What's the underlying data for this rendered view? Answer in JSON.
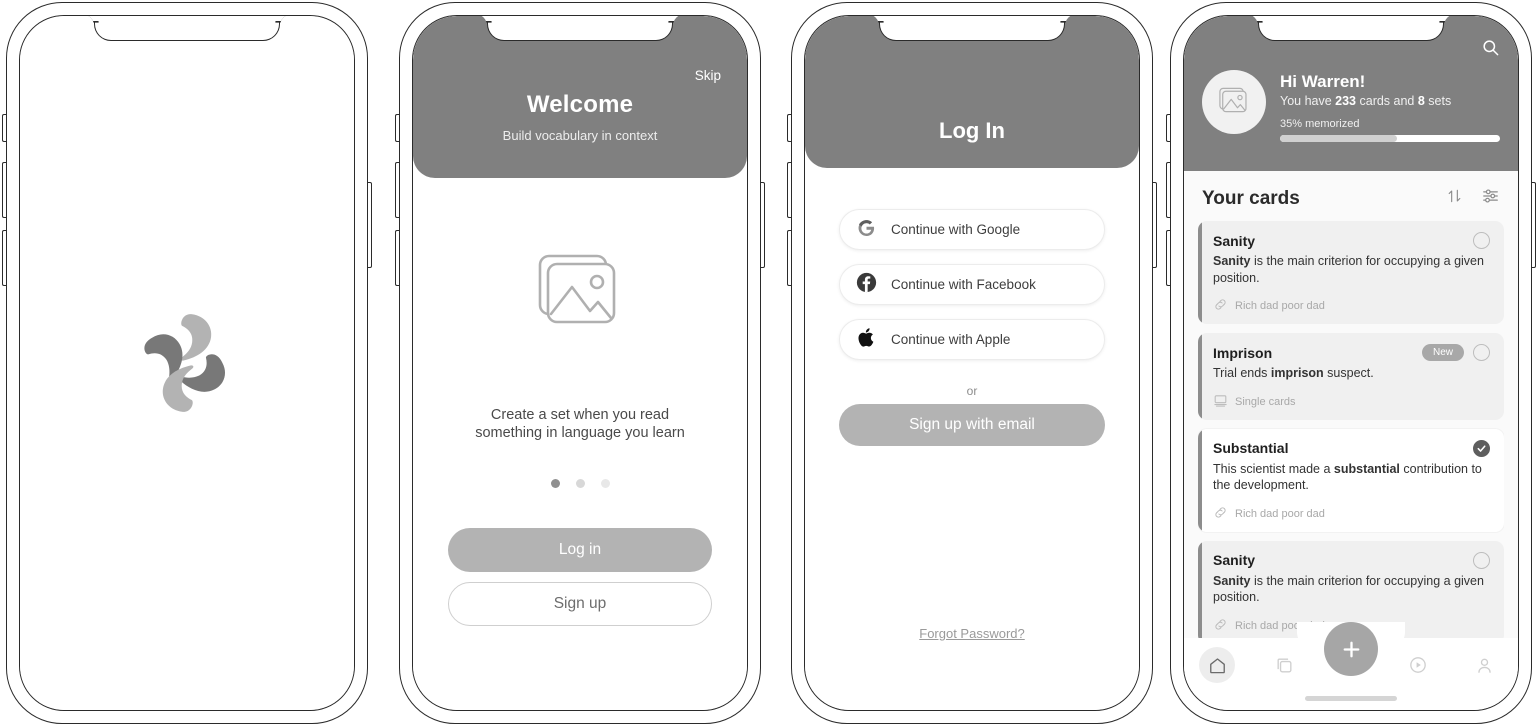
{
  "theme": {
    "header_gray": "#808080",
    "accent_gray": "#b3b3b3",
    "logo_dark": "#787878",
    "logo_light": "#b3b3b3",
    "card_bg": "#f0f0f0",
    "text_dark": "#1f1f1f"
  },
  "screens": [
    {
      "id": "splash",
      "name": "Splash",
      "logo_icon": "pinwheel-quotes-logo"
    },
    {
      "id": "welcome",
      "name": "Welcome / Onboarding",
      "skip_label": "Skip",
      "title": "Welcome",
      "subtitle": "Build vocabulary in context",
      "illustration_icon": "image-placeholder-icon",
      "body_line1": "Create a set when you read",
      "body_line2": "something in language you learn",
      "dots": [
        {
          "active": true,
          "color": "#909090"
        },
        {
          "active": false,
          "color": "#d8d8d8"
        },
        {
          "active": false,
          "color": "#e8e8e8"
        }
      ],
      "primary_button": "Log  in",
      "secondary_button": "Sign up"
    },
    {
      "id": "login",
      "name": "Log In",
      "title": "Log In",
      "social_buttons": [
        {
          "icon": "google-icon",
          "label": "Continue with Google"
        },
        {
          "icon": "facebook-icon",
          "label": "Continue with Facebook"
        },
        {
          "icon": "apple-icon",
          "label": "Continue with Apple"
        }
      ],
      "or_label": "or",
      "email_button": "Sign up with email",
      "forgot_label": "Forgot Password?"
    },
    {
      "id": "home",
      "name": "Your Cards",
      "search_icon": "search-icon",
      "avatar_icon": "image-placeholder-icon",
      "greeting": "Hi Warren!",
      "stats_prefix": "You have ",
      "stats_cards_count": "233",
      "stats_middle": " cards and ",
      "stats_sets_count": "8",
      "stats_suffix": " sets",
      "memorized_label": "35% memorized",
      "memorized_percent": 53,
      "section_title": "Your cards",
      "sort_icon": "sort-arrows-icon",
      "filter_icon": "filter-sliders-icon",
      "cards": [
        {
          "title": "Sanity",
          "sentence_parts": [
            {
              "text": "Sanity",
              "bold": true
            },
            {
              "text": " is the main criterion for occupying a given position.",
              "bold": false
            }
          ],
          "source_icon": "link-icon",
          "source": "Rich dad poor dad",
          "badge": null,
          "checked": false,
          "style": "alt"
        },
        {
          "title": "Imprison",
          "sentence_parts": [
            {
              "text": "Trial ends ",
              "bold": false
            },
            {
              "text": "imprison",
              "bold": true
            },
            {
              "text": " suspect.",
              "bold": false
            }
          ],
          "source_icon": "single-card-icon",
          "source": "Single cards",
          "badge": "New",
          "checked": false,
          "style": "alt"
        },
        {
          "title": "Substantial",
          "sentence_parts": [
            {
              "text": "This scientist made a ",
              "bold": false
            },
            {
              "text": "substantial",
              "bold": true
            },
            {
              "text": " contribution to the development.",
              "bold": false
            }
          ],
          "source_icon": "link-icon",
          "source": "Rich dad poor dad",
          "badge": null,
          "checked": true,
          "style": "plain"
        },
        {
          "title": "Sanity",
          "sentence_parts": [
            {
              "text": "Sanity",
              "bold": true
            },
            {
              "text": " is the main criterion for occupying a given position.",
              "bold": false
            }
          ],
          "source_icon": "link-icon",
          "source": "Rich dad poor dad",
          "badge": null,
          "checked": false,
          "style": "alt"
        }
      ],
      "tabs": [
        {
          "icon": "home-icon",
          "active": true
        },
        {
          "icon": "cards-stack-icon",
          "active": false
        },
        {
          "icon": "play-circle-icon",
          "active": false
        },
        {
          "icon": "profile-icon",
          "active": false
        }
      ],
      "fab_icon": "plus-icon"
    }
  ]
}
